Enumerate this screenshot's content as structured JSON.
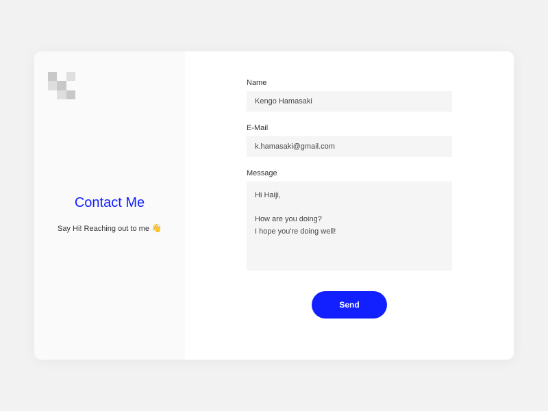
{
  "sidebar": {
    "title": "Contact Me",
    "subtitle_text": "Say Hi! Reaching out to me ",
    "wave_emoji": "👋"
  },
  "form": {
    "name": {
      "label": "Name",
      "value": "Kengo Hamasaki"
    },
    "email": {
      "label": "E-Mail",
      "value": "k.hamasaki@gmail.com"
    },
    "message": {
      "label": "Message",
      "value": "Hi Haiji,\n\nHow are you doing?\nI hope you're doing well!"
    },
    "send_label": "Send"
  },
  "colors": {
    "accent": "#1220ff"
  }
}
